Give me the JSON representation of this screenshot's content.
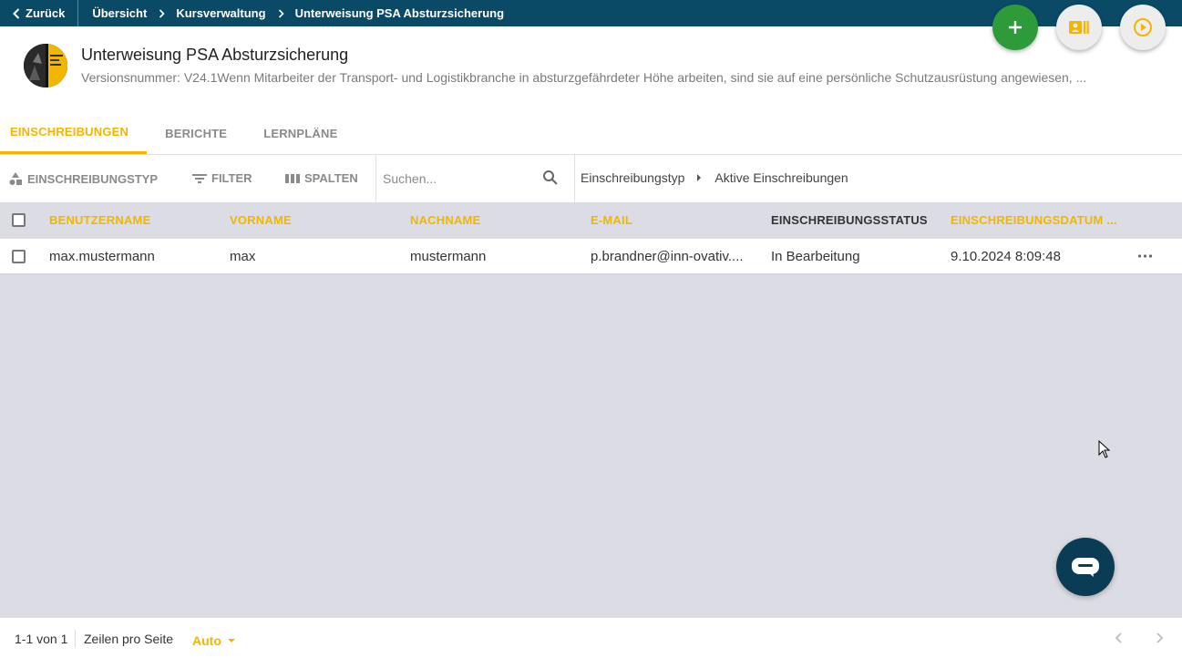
{
  "topbar": {
    "back_label": "Zurück",
    "breadcrumbs": [
      "Übersicht",
      "Kursverwaltung",
      "Unterweisung PSA Absturzsicherung"
    ]
  },
  "course": {
    "title": "Unterweisung PSA Absturzsicherung",
    "subtitle": "Versionsnummer: V24.1Wenn Mitarbeiter der Transport- und Logistikbranche in absturzgefährdeter Höhe arbeiten, sind sie auf eine persönliche Schutzausrüstung angewiesen, ..."
  },
  "tabs": [
    {
      "label": "EINSCHREIBUNGEN",
      "active": true
    },
    {
      "label": "BERICHTE",
      "active": false
    },
    {
      "label": "LERNPLÄNE",
      "active": false
    }
  ],
  "toolbar": {
    "type_label": "EINSCHREIBUNGSTYP",
    "filter_label": "FILTER",
    "columns_label": "SPALTEN",
    "search_placeholder": "Suchen...",
    "filter_path": [
      "Einschreibungstyp",
      "Aktive Einschreibungen"
    ]
  },
  "table": {
    "columns": [
      "BENUTZERNAME",
      "VORNAME",
      "NACHNAME",
      "E-MAIL",
      "EINSCHREIBUNGSSTATUS",
      "EINSCHREIBUNGSDATUM ..."
    ],
    "rows": [
      {
        "username": "max.mustermann",
        "firstname": "max",
        "lastname": "mustermann",
        "email": "p.brandner@inn-ovativ....",
        "status": "In Bearbeitung",
        "date": "9.10.2024 8:09:48"
      }
    ]
  },
  "footer": {
    "count": "1-1 von 1",
    "rows_label": "Zeilen pro Seite",
    "rows_value": "Auto"
  },
  "colors": {
    "topbar": "#0a4a66",
    "accent": "#f2b600",
    "add_button": "#2e9b3a",
    "chat_button": "#0a3d55",
    "grid_background": "#dcdce4"
  },
  "icons": [
    "chevron-left-icon",
    "chevron-right-icon",
    "plus-icon",
    "contact-card-icon",
    "play-circle-icon",
    "shapes-icon",
    "filter-icon",
    "columns-icon",
    "search-icon",
    "caret-right-icon",
    "more-horizontal-icon",
    "chat-icon",
    "caret-down-icon"
  ]
}
